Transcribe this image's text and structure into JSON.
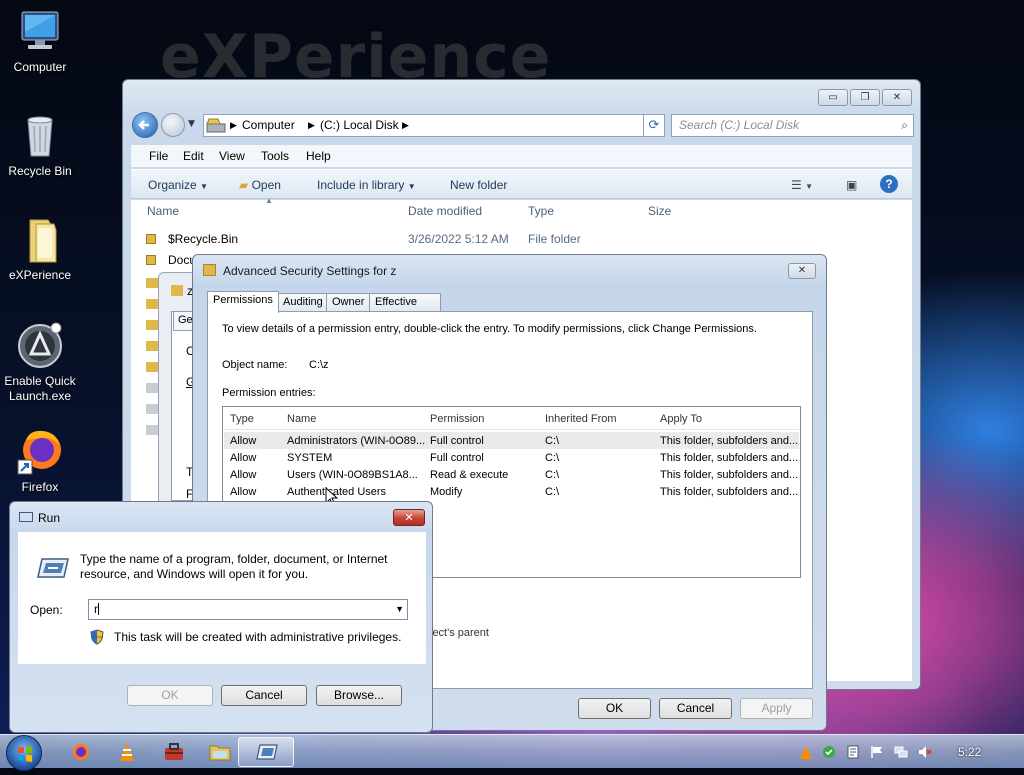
{
  "desktop": {
    "brand": "eXPerience",
    "icons": [
      {
        "label": "Computer",
        "icon": "computer-icon"
      },
      {
        "label": "Recycle Bin",
        "icon": "recycle-bin-icon"
      },
      {
        "label": "eXPerience",
        "icon": "folder-icon"
      },
      {
        "label": "Enable Quick Launch.exe",
        "icon": "quick-launch-icon"
      },
      {
        "label": "Firefox",
        "icon": "firefox-icon"
      }
    ]
  },
  "explorer": {
    "breadcrumb": [
      "Computer",
      "(C:) Local Disk"
    ],
    "search_placeholder": "Search (C:) Local Disk",
    "menu": [
      "File",
      "Edit",
      "View",
      "Tools",
      "Help"
    ],
    "commands": {
      "organize": "Organize",
      "open": "Open",
      "include": "Include in library",
      "new_folder": "New folder"
    },
    "columns": [
      "Name",
      "Date modified",
      "Type",
      "Size"
    ],
    "rows": [
      {
        "name": "$Recycle.Bin",
        "date": "3/26/2022 5:12 AM",
        "type": "File folder",
        "size": ""
      },
      {
        "name": "Docu",
        "date": "",
        "type": "",
        "size": ""
      }
    ],
    "caption_buttons": [
      "minimize",
      "maximize",
      "close"
    ]
  },
  "properties_fragment": {
    "tab_partial": "Ge",
    "title_partial": "z",
    "text_partial_1": "C",
    "text_partial_2": "G",
    "text_partial_3": "T",
    "text_partial_4": "F"
  },
  "advanced_security": {
    "title": "Advanced Security Settings for z",
    "tabs": [
      "Permissions",
      "Auditing",
      "Owner",
      "Effective Permissions"
    ],
    "active_tab": "Permissions",
    "intro": "To view details of a permission entry, double-click the entry. To modify permissions, click Change Permissions.",
    "object_name_label": "Object name:",
    "object_name_value": "C:\\z",
    "entries_label": "Permission entries:",
    "columns": [
      "Type",
      "Name",
      "Permission",
      "Inherited From",
      "Apply To"
    ],
    "entries": [
      {
        "type": "Allow",
        "name": "Administrators (WIN-0O89...",
        "permission": "Full control",
        "inherited": "C:\\",
        "apply": "This folder, subfolders and..."
      },
      {
        "type": "Allow",
        "name": "SYSTEM",
        "permission": "Full control",
        "inherited": "C:\\",
        "apply": "This folder, subfolders and..."
      },
      {
        "type": "Allow",
        "name": "Users (WIN-0O89BS1A8...",
        "permission": "Read & execute",
        "inherited": "C:\\",
        "apply": "This folder, subfolders and..."
      },
      {
        "type": "Allow",
        "name": "Authenticated Users",
        "permission": "Modify",
        "inherited": "C:\\",
        "apply": "This folder, subfolders and..."
      }
    ],
    "partial_text": "ject's parent",
    "buttons": {
      "ok": "OK",
      "cancel": "Cancel",
      "apply": "Apply"
    }
  },
  "run_dialog": {
    "title": "Run",
    "description": "Type the name of a program, folder, document, or Internet resource, and Windows will open it for you.",
    "open_label": "Open:",
    "open_value": "r",
    "admin_note": "This task will be created with administrative privileges.",
    "buttons": {
      "ok": "OK",
      "cancel": "Cancel",
      "browse": "Browse..."
    }
  },
  "taskbar": {
    "items": [
      "start-orb",
      "firefox-icon",
      "vlc-icon",
      "toolbox-icon",
      "explorer-icon",
      "run-icon"
    ],
    "clock": "5:22"
  }
}
